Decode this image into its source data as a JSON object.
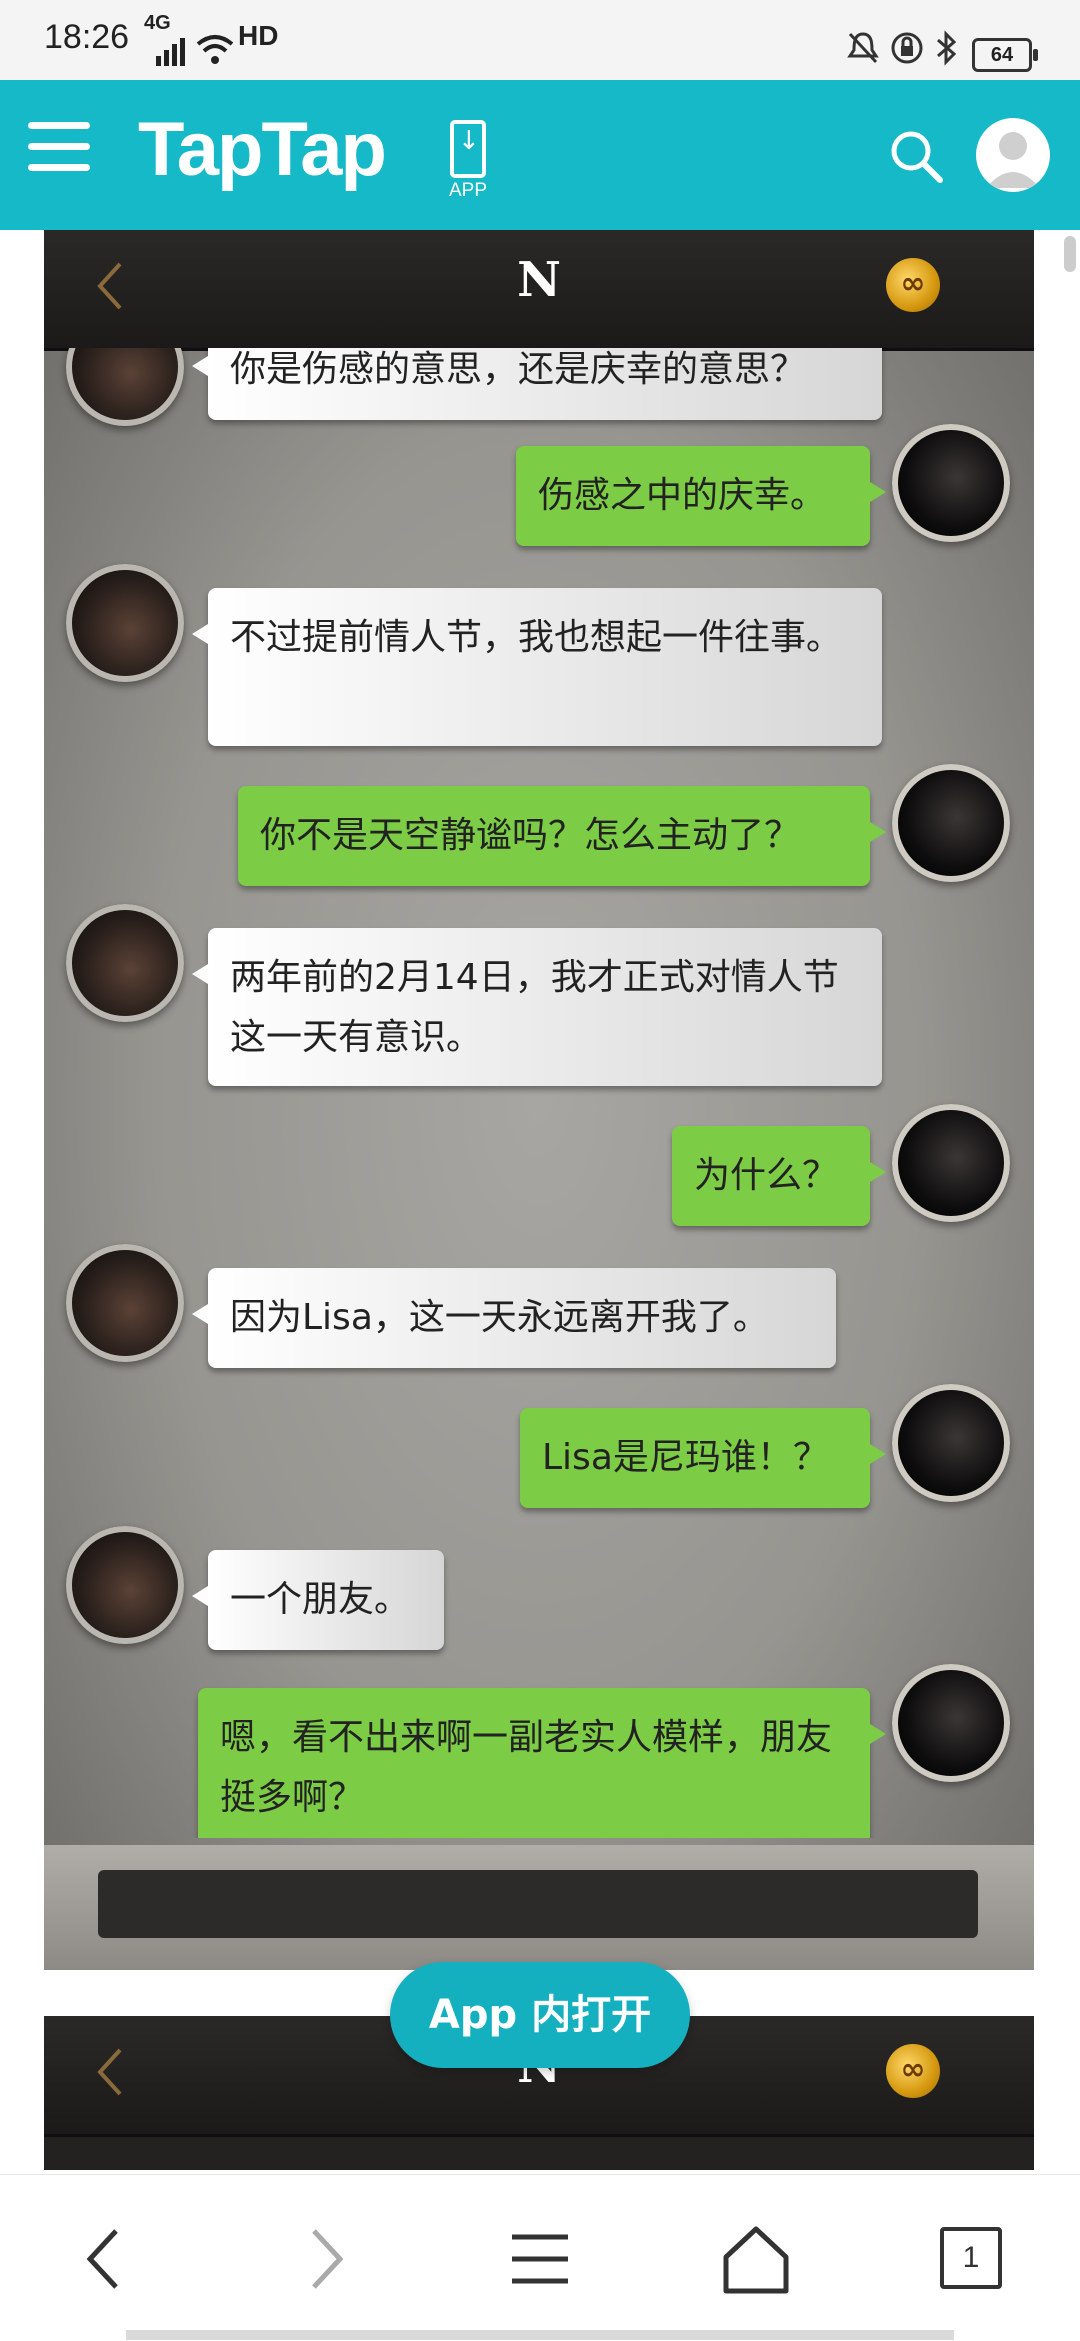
{
  "status_bar": {
    "time": "18:26",
    "network": "4G",
    "hd": "HD",
    "battery": "64"
  },
  "header": {
    "logo": "TapTap",
    "app_download_label": "APP",
    "brand_color": "#15b9c8"
  },
  "game": {
    "title": "N",
    "badge": "∞",
    "messages": [
      {
        "side": "left",
        "text": "你是伤感的意思，还是庆幸的意思？"
      },
      {
        "side": "right",
        "text": "伤感之中的庆幸。"
      },
      {
        "side": "left",
        "text": "不过提前情人节，我也想起一件往事。"
      },
      {
        "side": "right",
        "text": "你不是天空静谧吗？怎么主动了？"
      },
      {
        "side": "left",
        "text": "两年前的2月14日，我才正式对情人节这一天有意识。"
      },
      {
        "side": "right",
        "text": "为什么？"
      },
      {
        "side": "left",
        "text": "因为Lisa，这一天永远离开我了。"
      },
      {
        "side": "right",
        "text": "Lisa是尼玛谁！？"
      },
      {
        "side": "left",
        "text": "一个朋友。"
      },
      {
        "side": "right",
        "text": "嗯，看不出来啊一副老实人模样，朋友挺多啊？"
      }
    ]
  },
  "game2": {
    "title": "N",
    "badge": "∞"
  },
  "open_in_app_button": "App 内打开",
  "bottom_nav": {
    "tab_count": "1"
  }
}
